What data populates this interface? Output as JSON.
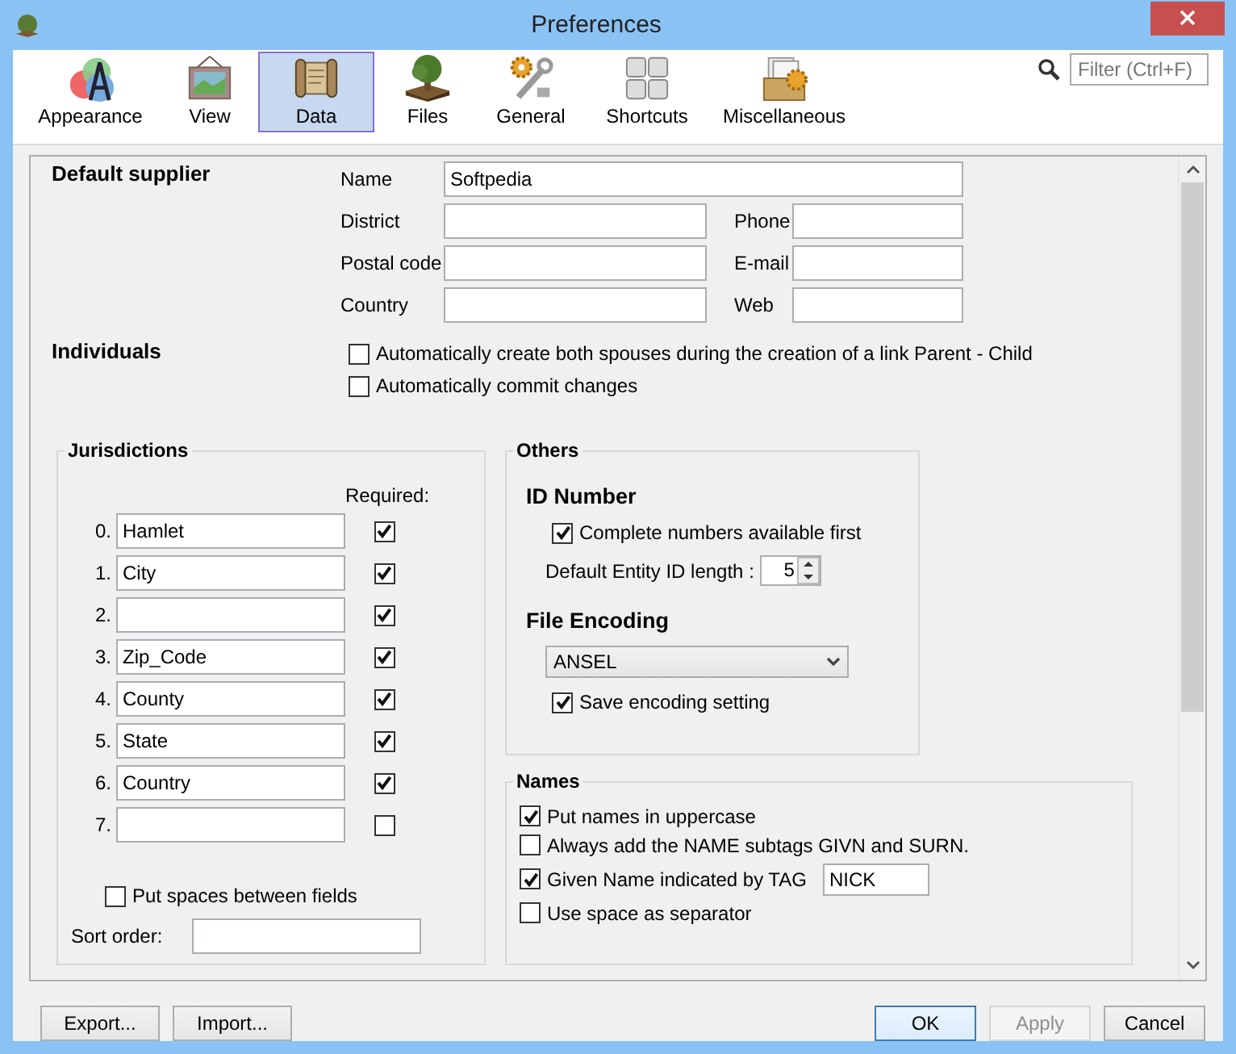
{
  "window": {
    "title": "Preferences"
  },
  "toolbar": {
    "tabs": [
      {
        "label": "Appearance",
        "kind": "appearance",
        "selected": false
      },
      {
        "label": "View",
        "kind": "view",
        "selected": false
      },
      {
        "label": "Data",
        "kind": "data",
        "selected": true
      },
      {
        "label": "Files",
        "kind": "files",
        "selected": false
      },
      {
        "label": "General",
        "kind": "general",
        "selected": false
      },
      {
        "label": "Shortcuts",
        "kind": "shortcuts",
        "selected": false
      },
      {
        "label": "Miscellaneous",
        "kind": "misc",
        "selected": false
      }
    ],
    "filter": {
      "placeholder": "Filter (Ctrl+F)"
    }
  },
  "default_supplier": {
    "heading": "Default supplier",
    "fields": [
      {
        "label": "Name",
        "value": "Softpedia",
        "kind": "wide"
      },
      {
        "label": "District",
        "kind": "left"
      },
      {
        "label": "Phone",
        "kind": "right"
      },
      {
        "label": "Postal code",
        "kind": "left"
      },
      {
        "label": "E-mail",
        "kind": "right"
      },
      {
        "label": "Country",
        "kind": "left"
      },
      {
        "label": "Web",
        "kind": "right"
      }
    ]
  },
  "individuals": {
    "heading": "Individuals",
    "options": [
      {
        "label": "Automatically create both spouses during the creation of a link Parent - Child",
        "checked": false
      },
      {
        "label": "Automatically commit changes",
        "checked": false
      }
    ]
  },
  "jurisdictions": {
    "heading": "Jurisdictions",
    "required_label": "Required:",
    "rows": [
      {
        "index": "0.",
        "value": "Hamlet",
        "required": true
      },
      {
        "index": "1.",
        "value": "City",
        "required": true
      },
      {
        "index": "2.",
        "required": true
      },
      {
        "index": "3.",
        "value": "Zip_Code",
        "required": true
      },
      {
        "index": "4.",
        "value": "County",
        "required": true
      },
      {
        "index": "5.",
        "value": "State",
        "required": true
      },
      {
        "index": "6.",
        "value": "Country",
        "required": true
      },
      {
        "index": "7.",
        "required": false
      }
    ],
    "spaces_option": {
      "label": "Put spaces between fields",
      "checked": false
    },
    "sort_order": {
      "label": "Sort order:"
    }
  },
  "others": {
    "heading": "Others",
    "id_number": {
      "heading": "ID Number",
      "complete_option": {
        "label": "Complete numbers available first",
        "checked": true
      },
      "length_label": "Default Entity ID length :",
      "length_value": "5"
    },
    "file_encoding": {
      "heading": "File Encoding",
      "value": "ANSEL",
      "save_option": {
        "label": "Save encoding setting",
        "checked": true
      }
    }
  },
  "names": {
    "heading": "Names",
    "options": [
      {
        "label": "Put names in uppercase",
        "checked": true,
        "kind": "check"
      },
      {
        "label": "Always add the NAME subtags GIVN and SURN.",
        "checked": false,
        "kind": "check"
      },
      {
        "label": "Given Name indicated by TAG",
        "checked": true,
        "kind": "check_field",
        "value": "NICK"
      },
      {
        "label": "Use space as separator",
        "checked": false,
        "kind": "check"
      }
    ]
  },
  "buttons": [
    {
      "label": "Export...",
      "kind": "left",
      "disabled": false,
      "default": false
    },
    {
      "label": "Import...",
      "kind": "left",
      "disabled": false,
      "default": false
    },
    {
      "label": "OK",
      "kind": "right",
      "disabled": false,
      "default": true
    },
    {
      "label": "Apply",
      "kind": "right",
      "disabled": true,
      "default": false
    },
    {
      "label": "Cancel",
      "kind": "right",
      "disabled": false,
      "default": false
    }
  ]
}
